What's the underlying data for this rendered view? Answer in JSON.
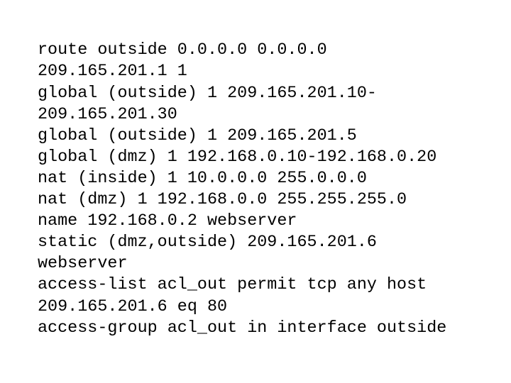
{
  "document": {
    "type": "configuration-listing",
    "background_color": "#ffffff",
    "text_color": "#000000",
    "lines": [
      "route outside 0.0.0.0 0.0.0.0",
      "209.165.201.1 1",
      "global (outside) 1 209.165.201.10-",
      "209.165.201.30",
      "global (outside) 1 209.165.201.5",
      "global (dmz) 1 192.168.0.10-192.168.0.20",
      "nat (inside) 1 10.0.0.0 255.0.0.0",
      "nat (dmz) 1 192.168.0.0 255.255.255.0",
      "name 192.168.0.2 webserver",
      "static (dmz,outside) 209.165.201.6",
      "webserver",
      "access-list acl_out permit tcp any host",
      "209.165.201.6 eq 80",
      "access-group acl_out in interface outside"
    ]
  }
}
